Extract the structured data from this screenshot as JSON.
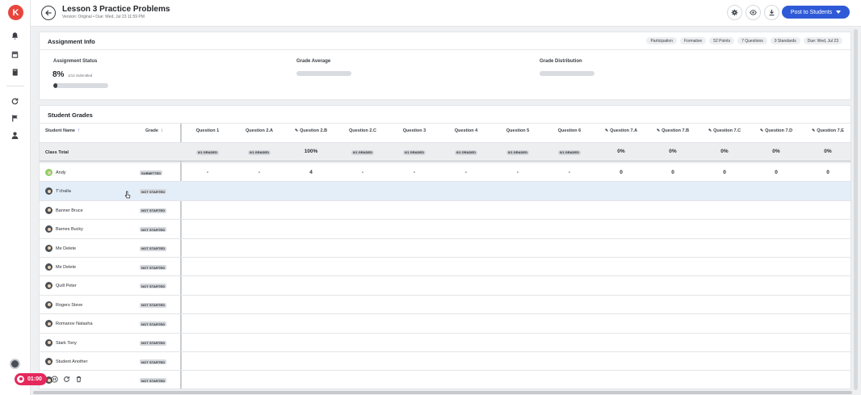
{
  "header": {
    "title": "Lesson 3 Practice Problems",
    "subtitle": "Version: Original • Due: Wed, Jul 23 11:59 PM",
    "post_button": "Post to Students"
  },
  "assignment_info": {
    "title": "Assignment Info",
    "chips": [
      "Participation",
      "Formative",
      "52 Points",
      "7 Questions",
      "0 Standards",
      "Due: Wed, Jul 23"
    ],
    "status_label": "Assignment Status",
    "status_percent": "8%",
    "status_sub": "1/12 Submitted",
    "status_progress": 0.08,
    "grade_average_label": "Grade Average",
    "grade_distribution_label": "Grade Distribution"
  },
  "student_grades": {
    "title": "Student Grades",
    "col_student_name": "Student Name",
    "col_grade": "Grade",
    "questions": [
      {
        "label": "Question 1",
        "ai": false
      },
      {
        "label": "Question 2.A",
        "ai": false
      },
      {
        "label": "Question 2.B",
        "ai": true
      },
      {
        "label": "Question 2.C",
        "ai": false
      },
      {
        "label": "Question 3",
        "ai": false
      },
      {
        "label": "Question 4",
        "ai": false
      },
      {
        "label": "Question 5",
        "ai": false
      },
      {
        "label": "Question 6",
        "ai": false
      },
      {
        "label": "Question 7.A",
        "ai": true
      },
      {
        "label": "Question 7.B",
        "ai": true
      },
      {
        "label": "Question 7.C",
        "ai": true
      },
      {
        "label": "Question 7.D",
        "ai": true
      },
      {
        "label": "Question 7.E",
        "ai": true
      }
    ],
    "class_total_label": "Class Total",
    "class_totals": [
      "0/1 GRADED",
      "0/1 GRADED",
      "100%",
      "0/1 GRADED",
      "0/1 GRADED",
      "0/1 GRADED",
      "0/1 GRADED",
      "0/1 GRADED",
      "0%",
      "0%",
      "0%",
      "0%",
      "0%"
    ],
    "students": [
      {
        "name": "Andy",
        "status": "SUBMITTED",
        "scores": [
          "-",
          "-",
          "4",
          "-",
          "-",
          "-",
          "-",
          "-",
          "0",
          "0",
          "0",
          "0",
          "0"
        ]
      },
      {
        "name": "T'challa",
        "status": "NOT STARTED",
        "scores": []
      },
      {
        "name": "Banner Bruce",
        "status": "NOT STARTED",
        "scores": []
      },
      {
        "name": "Barnes Bucky",
        "status": "NOT STARTED",
        "scores": []
      },
      {
        "name": "Me Delete",
        "status": "NOT STARTED",
        "scores": []
      },
      {
        "name": "Me Delete",
        "status": "NOT STARTED",
        "scores": []
      },
      {
        "name": "Quill Peter",
        "status": "NOT STARTED",
        "scores": []
      },
      {
        "name": "Rogers Steve",
        "status": "NOT STARTED",
        "scores": []
      },
      {
        "name": "Romanov Natasha",
        "status": "NOT STARTED",
        "scores": []
      },
      {
        "name": "Stark Tony",
        "status": "NOT STARTED",
        "scores": []
      },
      {
        "name": "Student Another",
        "status": "NOT STARTED",
        "scores": []
      },
      {
        "name": "",
        "status": "NOT STARTED",
        "scores": []
      }
    ]
  },
  "recorder": {
    "time": "01:00"
  },
  "icons": {
    "logo": "app-logo-icon",
    "rail": [
      "bell-icon",
      "store-icon",
      "book-icon",
      "refresh-icon",
      "flag-icon",
      "person-icon"
    ],
    "header": [
      "settings-icon",
      "eye-icon",
      "download-icon"
    ]
  },
  "colors": {
    "accent": "#2f5ad7",
    "logo": "#e8453c",
    "recorder": "#e5285c",
    "row_highlight": "#e4eef9"
  }
}
